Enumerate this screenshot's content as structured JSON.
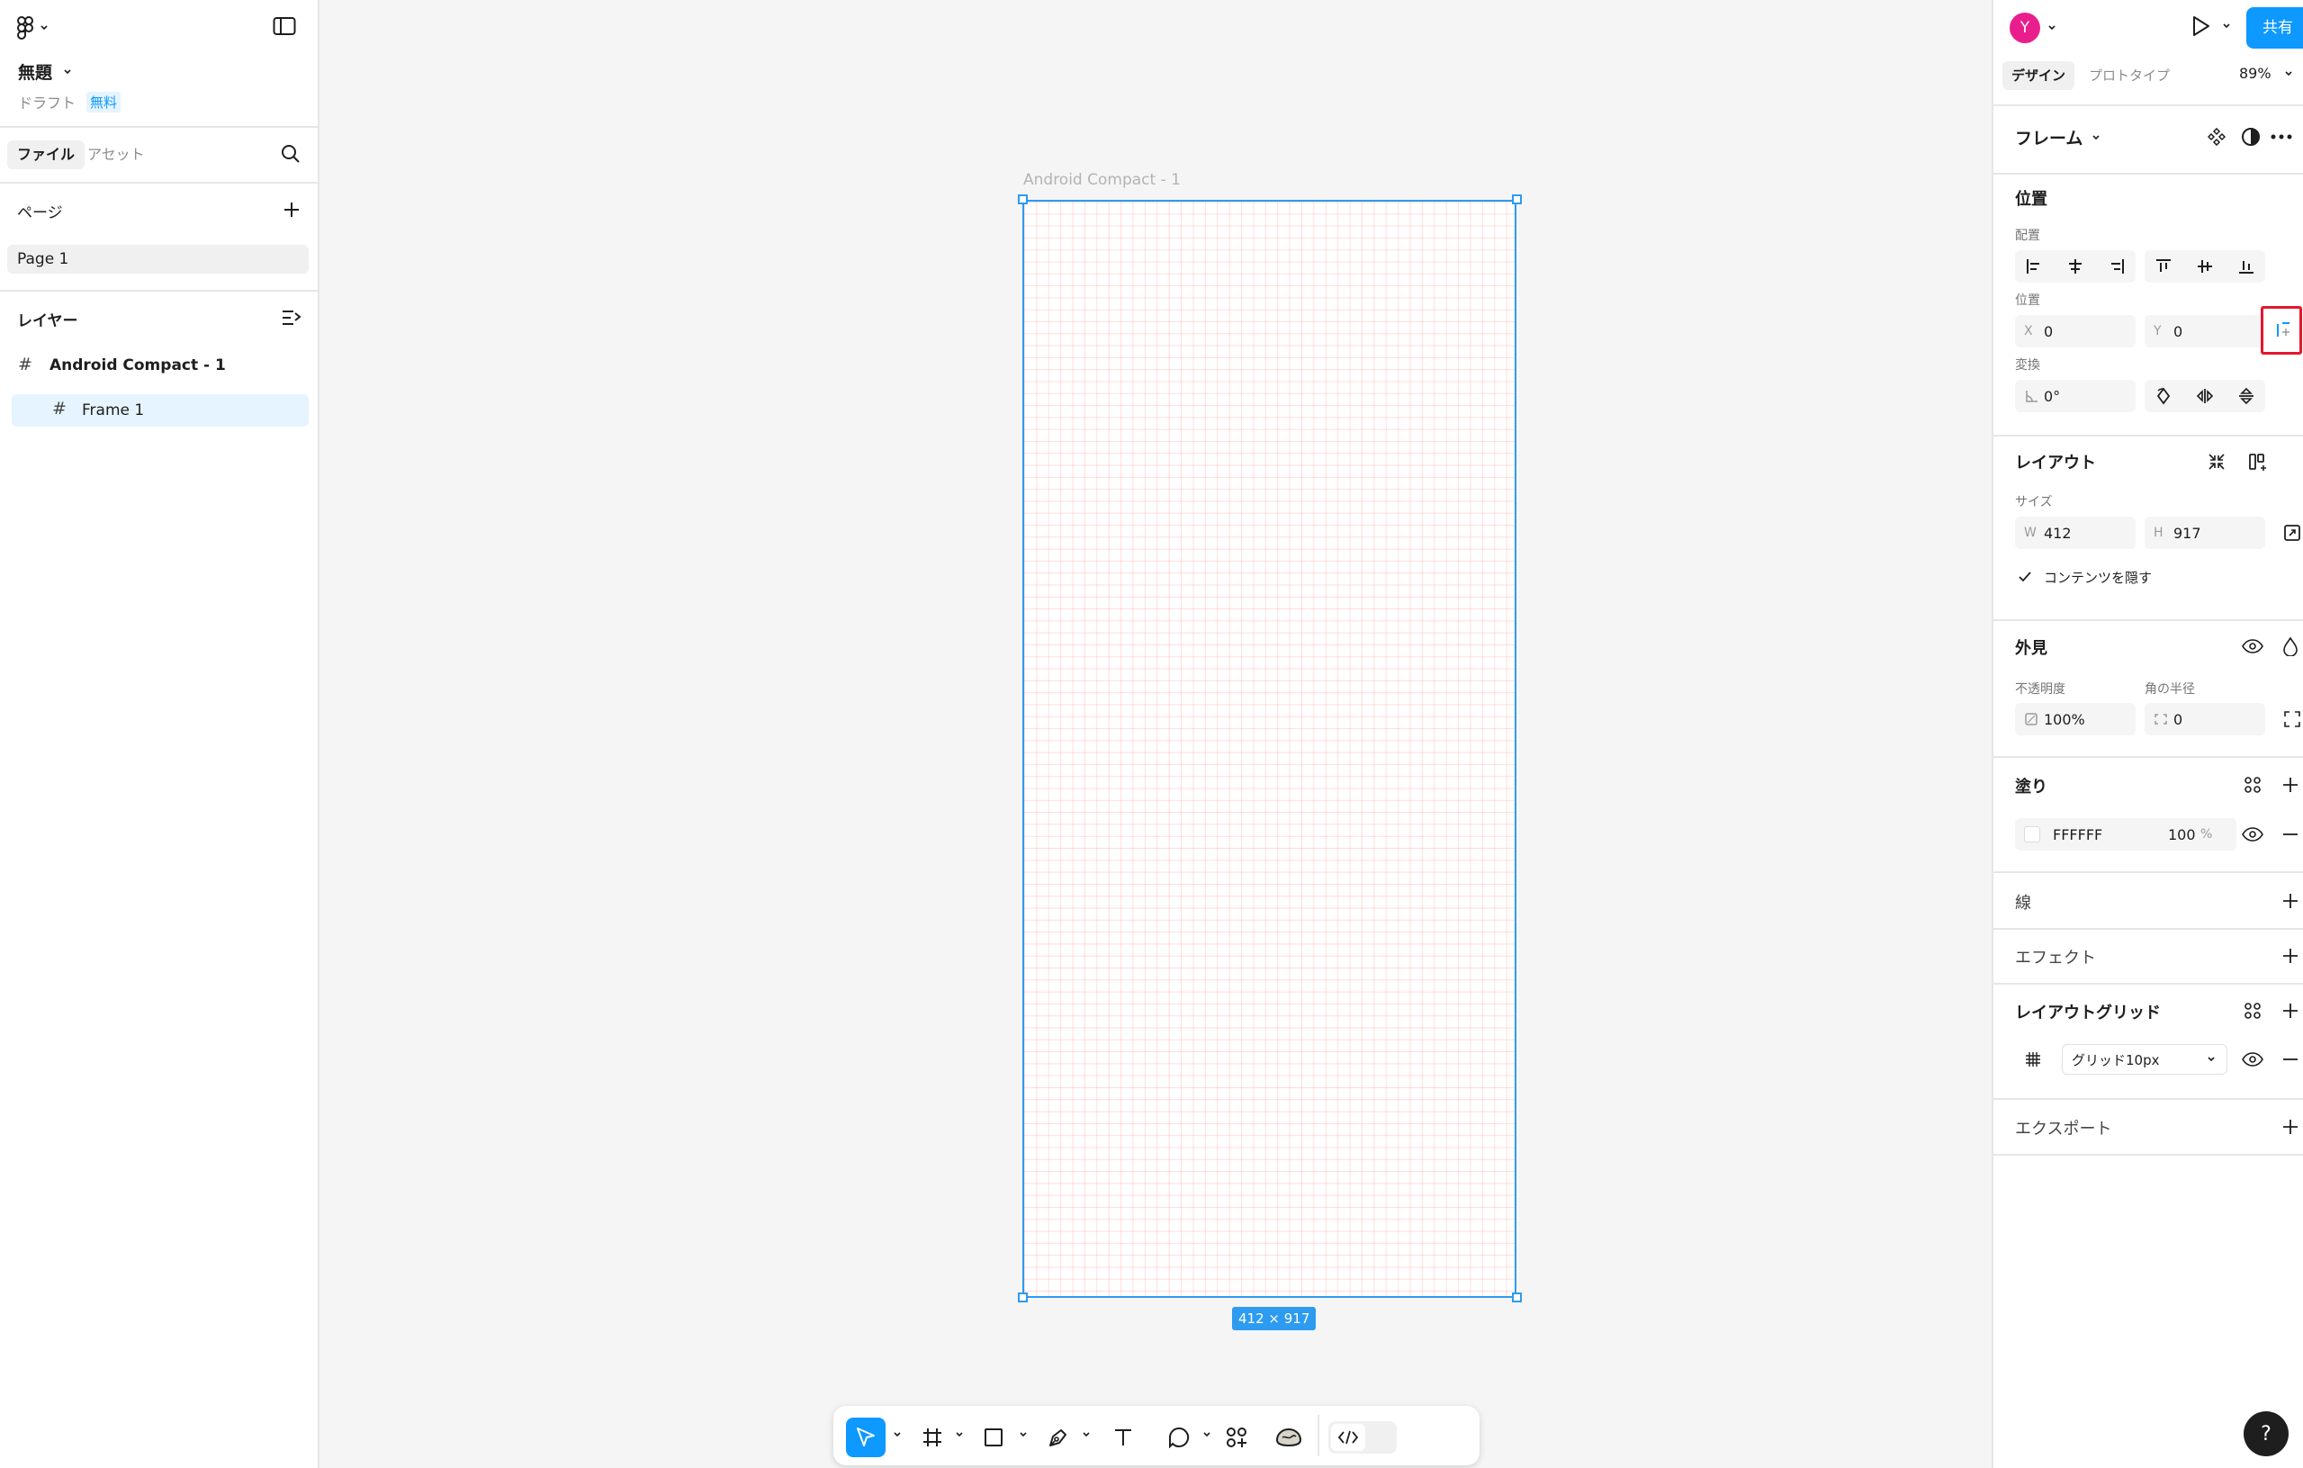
{
  "file": {
    "title": "無題",
    "subtitle": "ドラフト",
    "plan_badge": "無料"
  },
  "left_tabs": {
    "files": "ファイル",
    "assets": "アセット"
  },
  "pages": {
    "heading": "ページ",
    "items": [
      "Page 1"
    ]
  },
  "layers": {
    "heading": "レイヤー",
    "items": [
      {
        "label": "Android Compact - 1"
      },
      {
        "label": "Frame 1"
      }
    ]
  },
  "canvas": {
    "frame_label": "Android Compact - 1",
    "size_badge": "412 × 917"
  },
  "header": {
    "avatar_initial": "Y",
    "share_label": "共有",
    "tab_design": "デザイン",
    "tab_prototype": "プロトタイプ",
    "zoom": "89%"
  },
  "frame_section": {
    "label": "フレーム"
  },
  "position": {
    "title": "位置",
    "align_label": "配置",
    "position_label": "位置",
    "x_prefix": "X",
    "x_value": "0",
    "y_prefix": "Y",
    "y_value": "0",
    "transform_label": "変換",
    "rotation": "0°"
  },
  "layout": {
    "title": "レイアウト",
    "size_label": "サイズ",
    "w_prefix": "W",
    "w_value": "412",
    "h_prefix": "H",
    "h_value": "917",
    "clip_label": "コンテンツを隠す"
  },
  "appearance": {
    "title": "外見",
    "opacity_label": "不透明度",
    "opacity_value": "100%",
    "radius_label": "角の半径",
    "radius_value": "0"
  },
  "fill": {
    "title": "塗り",
    "hex": "FFFFFF",
    "opacity": "100",
    "pct": "%"
  },
  "stroke": {
    "title": "線"
  },
  "effects": {
    "title": "エフェクト"
  },
  "layout_grid": {
    "title": "レイアウトグリッド",
    "grid_value": "グリッド10px"
  },
  "export": {
    "title": "エクスポート"
  },
  "help": {
    "label": "?"
  },
  "colors": {
    "accent": "#0d99ff",
    "avatar": "#e91e8c",
    "selection": "#2d9bf0",
    "highlight": "#e5172f"
  }
}
